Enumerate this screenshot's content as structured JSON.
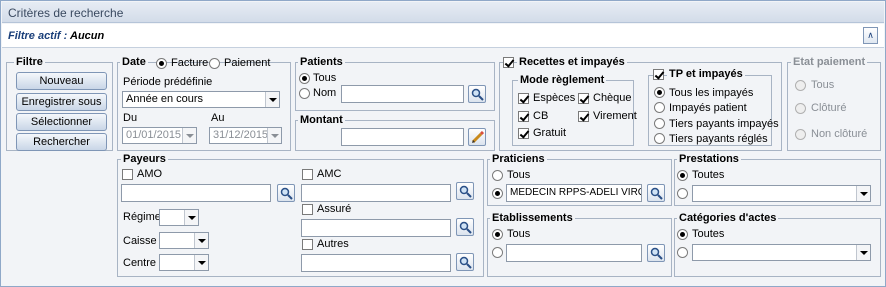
{
  "title": "Critères de recherche",
  "filter": {
    "label": "Filtre actif :",
    "value": "Aucun"
  },
  "filtre": {
    "title": "Filtre",
    "buttons": [
      "Nouveau",
      "Enregistrer sous",
      "Sélectionner",
      "Rechercher"
    ]
  },
  "date": {
    "title": "Date",
    "opt_facture": "Facture",
    "opt_paiement": "Paiement",
    "periode_label": "Période prédéfinie",
    "periode_value": "Année en cours",
    "du_label": "Du",
    "du_value": "01/01/2015",
    "au_label": "Au",
    "au_value": "31/12/2015"
  },
  "patients": {
    "title": "Patients",
    "opt_tous": "Tous",
    "opt_nom": "Nom",
    "nom_value": ""
  },
  "montant": {
    "title": "Montant",
    "value": ""
  },
  "recettes": {
    "title": "Recettes et impayés",
    "mode_title": "Mode règlement",
    "especes": "Espèces",
    "cheque": "Chèque",
    "cb": "CB",
    "virement": "Virement",
    "gratuit": "Gratuit",
    "tp_title": "TP et impayés",
    "tous_impayes": "Tous les impayés",
    "impayes_patient": "Impayés patient",
    "tiers_impayes": "Tiers payants impayés",
    "tiers_regles": "Tiers payants réglés"
  },
  "etat": {
    "title": "Etat paiement",
    "tous": "Tous",
    "cloture": "Clôturé",
    "non_cloture": "Non clôturé"
  },
  "payeurs": {
    "title": "Payeurs",
    "amo": "AMO",
    "amc": "AMC",
    "assure": "Assuré",
    "autres": "Autres",
    "regime": "Régime",
    "caisse": "Caisse",
    "centre": "Centre"
  },
  "praticiens": {
    "title": "Praticiens",
    "tous": "Tous",
    "value": "MEDECIN RPPS-ADELI VIRGINIE"
  },
  "etablissements": {
    "title": "Etablissements",
    "tous": "Tous"
  },
  "prestations": {
    "title": "Prestations",
    "toutes": "Toutes"
  },
  "categories": {
    "title": "Catégories d'actes",
    "toutes": "Toutes"
  }
}
